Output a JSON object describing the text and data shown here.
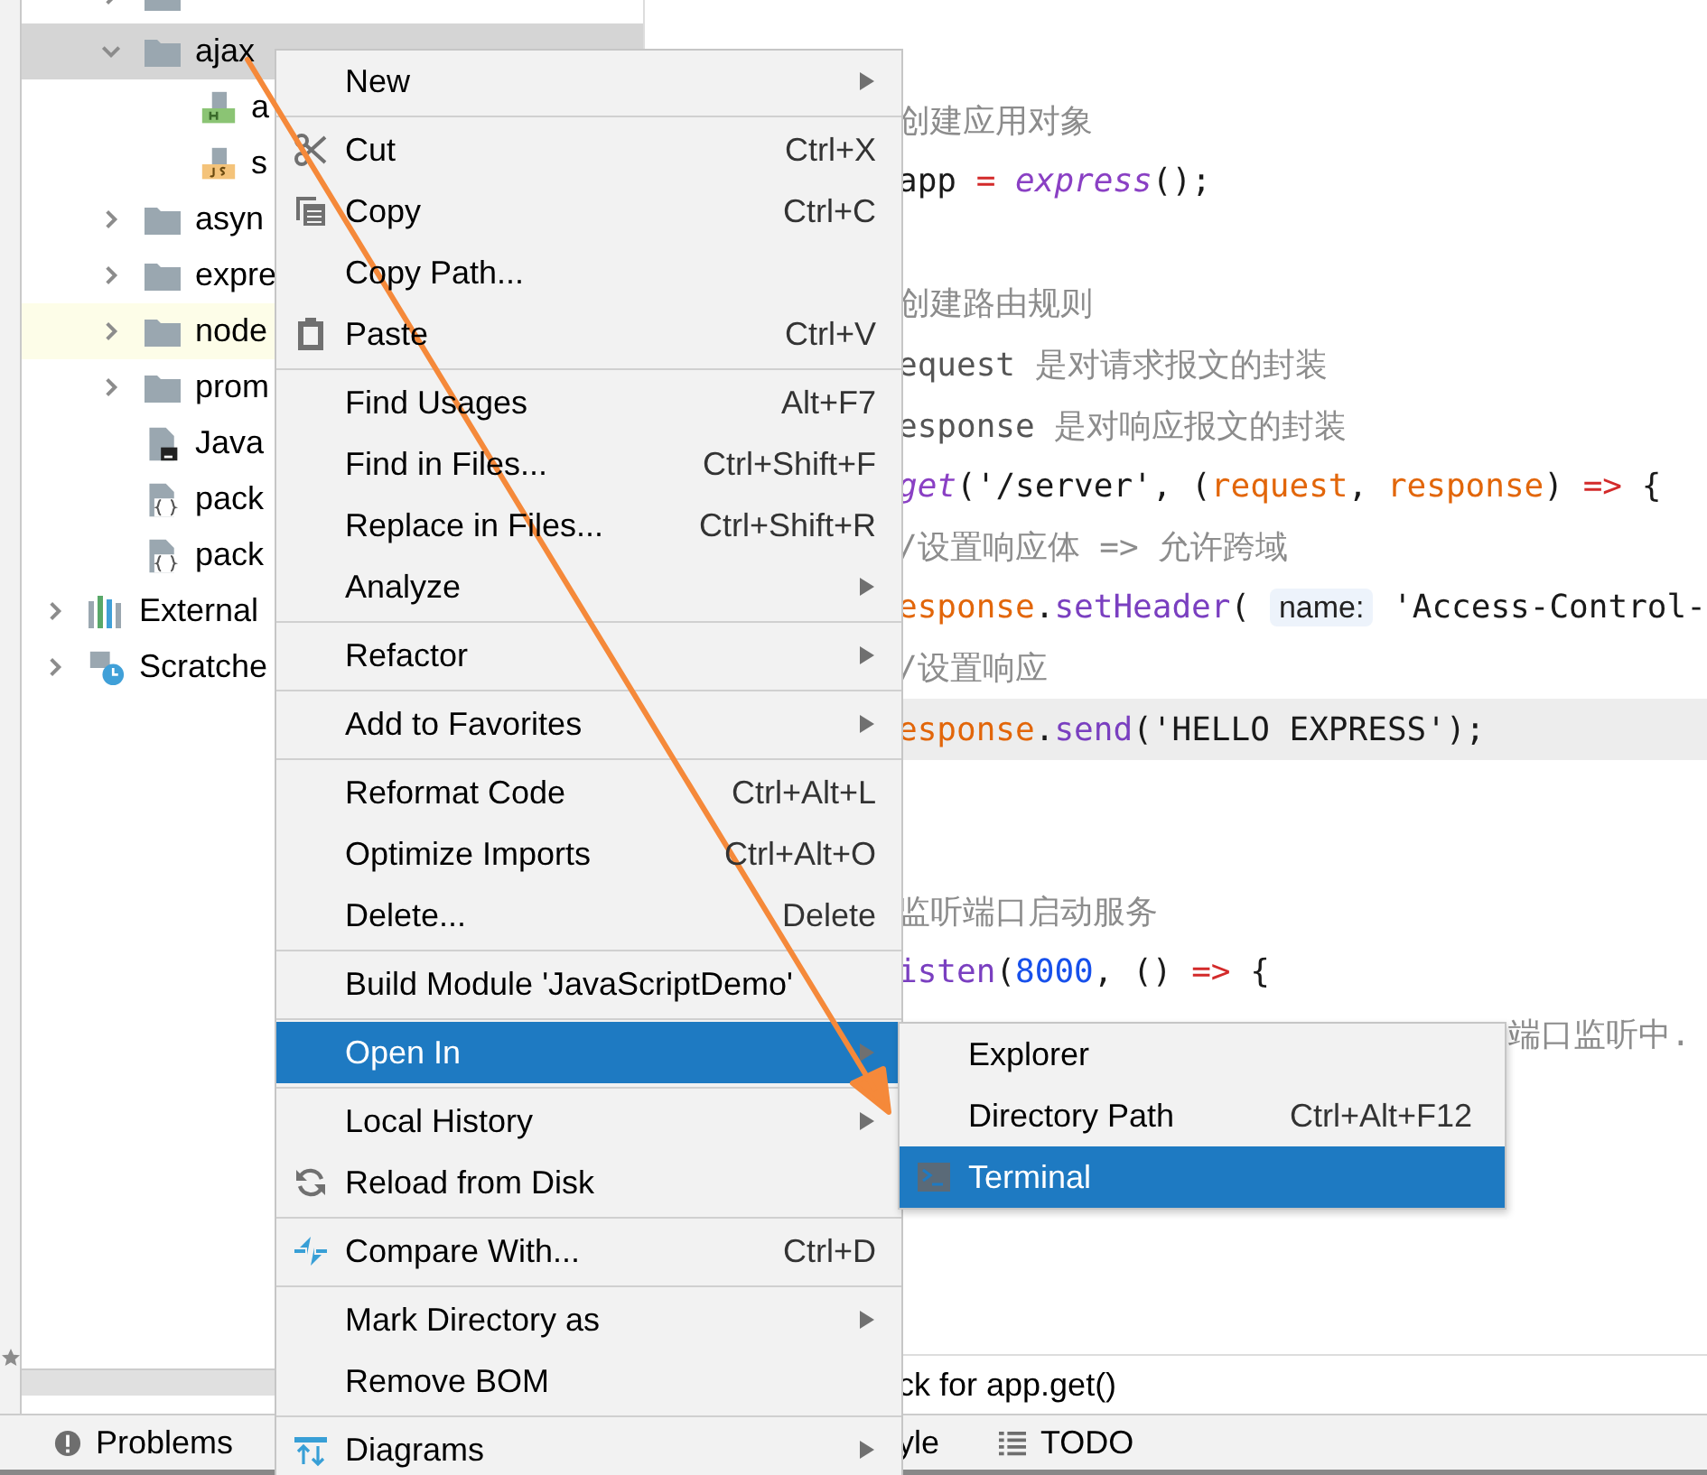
{
  "project_tree": {
    "items": [
      {
        "kind": "folder",
        "expanded": false,
        "selected": false,
        "highlighted": false
      },
      {
        "label": "ajax",
        "kind": "folder",
        "expanded": true,
        "selected": true,
        "highlighted": false,
        "children": [
          {
            "label": "a",
            "kind": "html",
            "selected": false,
            "highlighted": false
          },
          {
            "label": "s",
            "kind": "js",
            "selected": false,
            "highlighted": false
          }
        ]
      },
      {
        "label": "asyn",
        "kind": "folder",
        "expanded": false,
        "selected": false,
        "highlighted": false
      },
      {
        "label": "expre",
        "kind": "folder",
        "expanded": false,
        "selected": false,
        "highlighted": false
      },
      {
        "label": "node",
        "kind": "folder",
        "expanded": false,
        "selected": false,
        "highlighted": true
      },
      {
        "label": "prom",
        "kind": "folder",
        "expanded": false,
        "selected": false,
        "highlighted": false
      },
      {
        "label": "Java",
        "kind": "module_file",
        "selected": false,
        "highlighted": false
      },
      {
        "label": "pack",
        "kind": "json",
        "selected": false,
        "highlighted": false
      },
      {
        "label": "pack",
        "kind": "json",
        "selected": false,
        "highlighted": false
      }
    ],
    "roots": [
      {
        "label": "External",
        "kind": "library",
        "expanded": false,
        "selected": false,
        "highlighted": false
      },
      {
        "label": "Scratche",
        "kind": "scratches",
        "expanded": false,
        "selected": false,
        "highlighted": false
      }
    ]
  },
  "editor": {
    "lines": [
      {
        "kind": "blank"
      },
      {
        "kind": "blank"
      },
      {
        "kind": "behind_menu",
        "current": false,
        "segments": [
          {
            "kind": "comment",
            "text": "创建应用对象"
          }
        ]
      },
      {
        "kind": "behind_menu",
        "current": false,
        "segments": [
          {
            "kind": "plain",
            "text": "app"
          },
          {
            "kind": "keyword",
            "text": " = "
          },
          {
            "kind": "function",
            "text": "express"
          },
          {
            "kind": "plain",
            "text": "();"
          }
        ]
      },
      {
        "kind": "blank"
      },
      {
        "kind": "behind_menu",
        "current": false,
        "segments": [
          {
            "kind": "comment",
            "text": "创建路由规则"
          }
        ]
      },
      {
        "kind": "behind_menu",
        "current": false,
        "segments": [
          {
            "kind": "doc",
            "text": "equest"
          },
          {
            "kind": "comment",
            "text": " 是对请求报文的封装"
          }
        ]
      },
      {
        "kind": "behind_menu",
        "current": false,
        "segments": [
          {
            "kind": "doc",
            "text": "esponse"
          },
          {
            "kind": "comment",
            "text": " 是对响应报文的封装"
          }
        ]
      },
      {
        "kind": "behind_menu",
        "current": false,
        "segments": [
          {
            "kind": "function",
            "text": "get"
          },
          {
            "kind": "plain",
            "text": "('/server', ("
          },
          {
            "kind": "param",
            "text": "request"
          },
          {
            "kind": "plain",
            "text": ", "
          },
          {
            "kind": "param",
            "text": "response"
          },
          {
            "kind": "plain",
            "text": ") "
          },
          {
            "kind": "keyword",
            "text": "=>"
          },
          {
            "kind": "plain",
            "text": " {"
          }
        ]
      },
      {
        "kind": "behind_menu",
        "current": false,
        "segments": [
          {
            "kind": "comment",
            "text": "/设置响应体 => 允许跨域"
          }
        ]
      },
      {
        "kind": "behind_menu",
        "current": false,
        "segments": [
          {
            "kind": "param",
            "text": "esponse"
          },
          {
            "kind": "plain",
            "text": "."
          },
          {
            "kind": "method",
            "text": "setHeader"
          },
          {
            "kind": "plain",
            "text": "( "
          },
          {
            "kind": "hint",
            "text": "name:"
          },
          {
            "kind": "plain",
            "text": " 'Access-Control-"
          }
        ]
      },
      {
        "kind": "behind_menu",
        "current": false,
        "segments": [
          {
            "kind": "comment",
            "text": "/设置响应"
          }
        ]
      },
      {
        "kind": "behind_menu",
        "current": true,
        "segments": [
          {
            "kind": "param",
            "text": "esponse"
          },
          {
            "kind": "plain",
            "text": "."
          },
          {
            "kind": "method",
            "text": "send"
          },
          {
            "kind": "plain",
            "text": "('HELLO EXPRESS');"
          }
        ]
      },
      {
        "kind": "blank"
      },
      {
        "kind": "blank"
      },
      {
        "kind": "behind_menu",
        "current": false,
        "segments": [
          {
            "kind": "comment",
            "text": "监听端口启动服务"
          }
        ]
      },
      {
        "kind": "behind_menu",
        "current": false,
        "segments": [
          {
            "kind": "method",
            "text": "isten"
          },
          {
            "kind": "plain",
            "text": "("
          },
          {
            "kind": "number",
            "text": "8000"
          },
          {
            "kind": "plain",
            "text": ", () "
          },
          {
            "kind": "keyword",
            "text": "=>"
          },
          {
            "kind": "plain",
            "text": " {"
          }
        ]
      },
      {
        "kind": "behind_submenu",
        "current": false,
        "segments": [
          {
            "kind": "comment",
            "text": "端口监听中."
          }
        ]
      }
    ],
    "breadcrumb": "ck for app.get()"
  },
  "status_bar": [
    {
      "kind": "problems",
      "label": "Problems"
    },
    {
      "kind": "plain",
      "label": "yle"
    },
    {
      "kind": "todo",
      "label": "TODO"
    }
  ],
  "context_menu": [
    {
      "kind": "submenu",
      "label": "New",
      "selected": false
    },
    {
      "kind": "separator"
    },
    {
      "kind": "item",
      "label": "Cut",
      "shortcut": "Ctrl+X",
      "selected": false
    },
    {
      "kind": "item",
      "label": "Copy",
      "shortcut": "Ctrl+C",
      "selected": false
    },
    {
      "kind": "item",
      "label": "Copy Path...",
      "selected": false
    },
    {
      "kind": "item",
      "label": "Paste",
      "shortcut": "Ctrl+V",
      "selected": false
    },
    {
      "kind": "separator"
    },
    {
      "kind": "item",
      "label": "Find Usages",
      "shortcut": "Alt+F7",
      "selected": false
    },
    {
      "kind": "item",
      "label": "Find in Files...",
      "shortcut": "Ctrl+Shift+F",
      "selected": false
    },
    {
      "kind": "item",
      "label": "Replace in Files...",
      "shortcut": "Ctrl+Shift+R",
      "selected": false
    },
    {
      "kind": "submenu",
      "label": "Analyze",
      "selected": false
    },
    {
      "kind": "separator"
    },
    {
      "kind": "submenu",
      "label": "Refactor",
      "selected": false
    },
    {
      "kind": "separator"
    },
    {
      "kind": "submenu",
      "label": "Add to Favorites",
      "selected": false
    },
    {
      "kind": "separator"
    },
    {
      "kind": "item",
      "label": "Reformat Code",
      "shortcut": "Ctrl+Alt+L",
      "selected": false
    },
    {
      "kind": "item",
      "label": "Optimize Imports",
      "shortcut": "Ctrl+Alt+O",
      "selected": false
    },
    {
      "kind": "item",
      "label": "Delete...",
      "shortcut": "Delete",
      "selected": false
    },
    {
      "kind": "separator"
    },
    {
      "kind": "item",
      "label": "Build Module 'JavaScriptDemo'",
      "selected": false
    },
    {
      "kind": "separator"
    },
    {
      "kind": "submenu",
      "label": "Open In",
      "selected": true
    },
    {
      "kind": "separator"
    },
    {
      "kind": "submenu",
      "label": "Local History",
      "selected": false
    },
    {
      "kind": "item",
      "label": "Reload from Disk",
      "selected": false
    },
    {
      "kind": "separator"
    },
    {
      "kind": "item",
      "label": "Compare With...",
      "shortcut": "Ctrl+D",
      "selected": false
    },
    {
      "kind": "separator"
    },
    {
      "kind": "submenu",
      "label": "Mark Directory as",
      "selected": false
    },
    {
      "kind": "item",
      "label": "Remove BOM",
      "selected": false
    },
    {
      "kind": "separator"
    },
    {
      "kind": "submenu",
      "label": "Diagrams",
      "selected": false
    }
  ],
  "open_in_submenu": [
    {
      "label": "Explorer",
      "selected": false
    },
    {
      "label": "Directory Path",
      "shortcut": "Ctrl+Alt+F12",
      "selected": false
    },
    {
      "label": "Terminal",
      "selected": true
    }
  ]
}
